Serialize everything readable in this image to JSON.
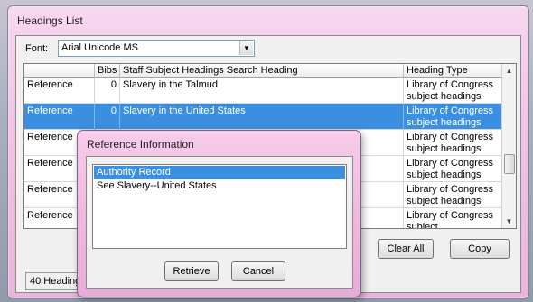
{
  "window": {
    "title": "Headings List"
  },
  "font": {
    "label": "Font:",
    "value": "Arial Unicode MS"
  },
  "grid": {
    "headers": [
      "",
      "Bibs",
      "Staff Subject Headings Search Heading",
      "Heading Type"
    ],
    "rows": [
      {
        "ref": "Reference",
        "bibs": "0",
        "heading": "Slavery in the Talmud",
        "type": "Library of Congress subject headings",
        "selected": false
      },
      {
        "ref": "Reference",
        "bibs": "0",
        "heading": "Slavery in the United States",
        "type": "Library of Congress subject headings",
        "selected": true
      },
      {
        "ref": "Reference",
        "bibs": "",
        "heading": "",
        "type": "Library of Congress subject headings",
        "selected": false
      },
      {
        "ref": "Reference",
        "bibs": "",
        "heading": "",
        "type": "Library of Congress subject headings",
        "selected": false
      },
      {
        "ref": "Reference",
        "bibs": "",
        "heading": "",
        "type": "Library of Congress subject headings",
        "selected": false
      },
      {
        "ref": "Reference",
        "bibs": "",
        "heading": "",
        "type": "Library of Congress subject",
        "selected": false
      }
    ]
  },
  "buttons": {
    "clear_all": "Clear All",
    "copy": "Copy"
  },
  "status": {
    "text": "40 Headings F"
  },
  "dialog": {
    "title": "Reference Information",
    "items": [
      "Authority Record",
      "See Slavery--United States"
    ],
    "retrieve": "Retrieve",
    "cancel": "Cancel"
  },
  "colors": {
    "selection": "#3a8fe0",
    "frame": "#f3c3e8"
  }
}
